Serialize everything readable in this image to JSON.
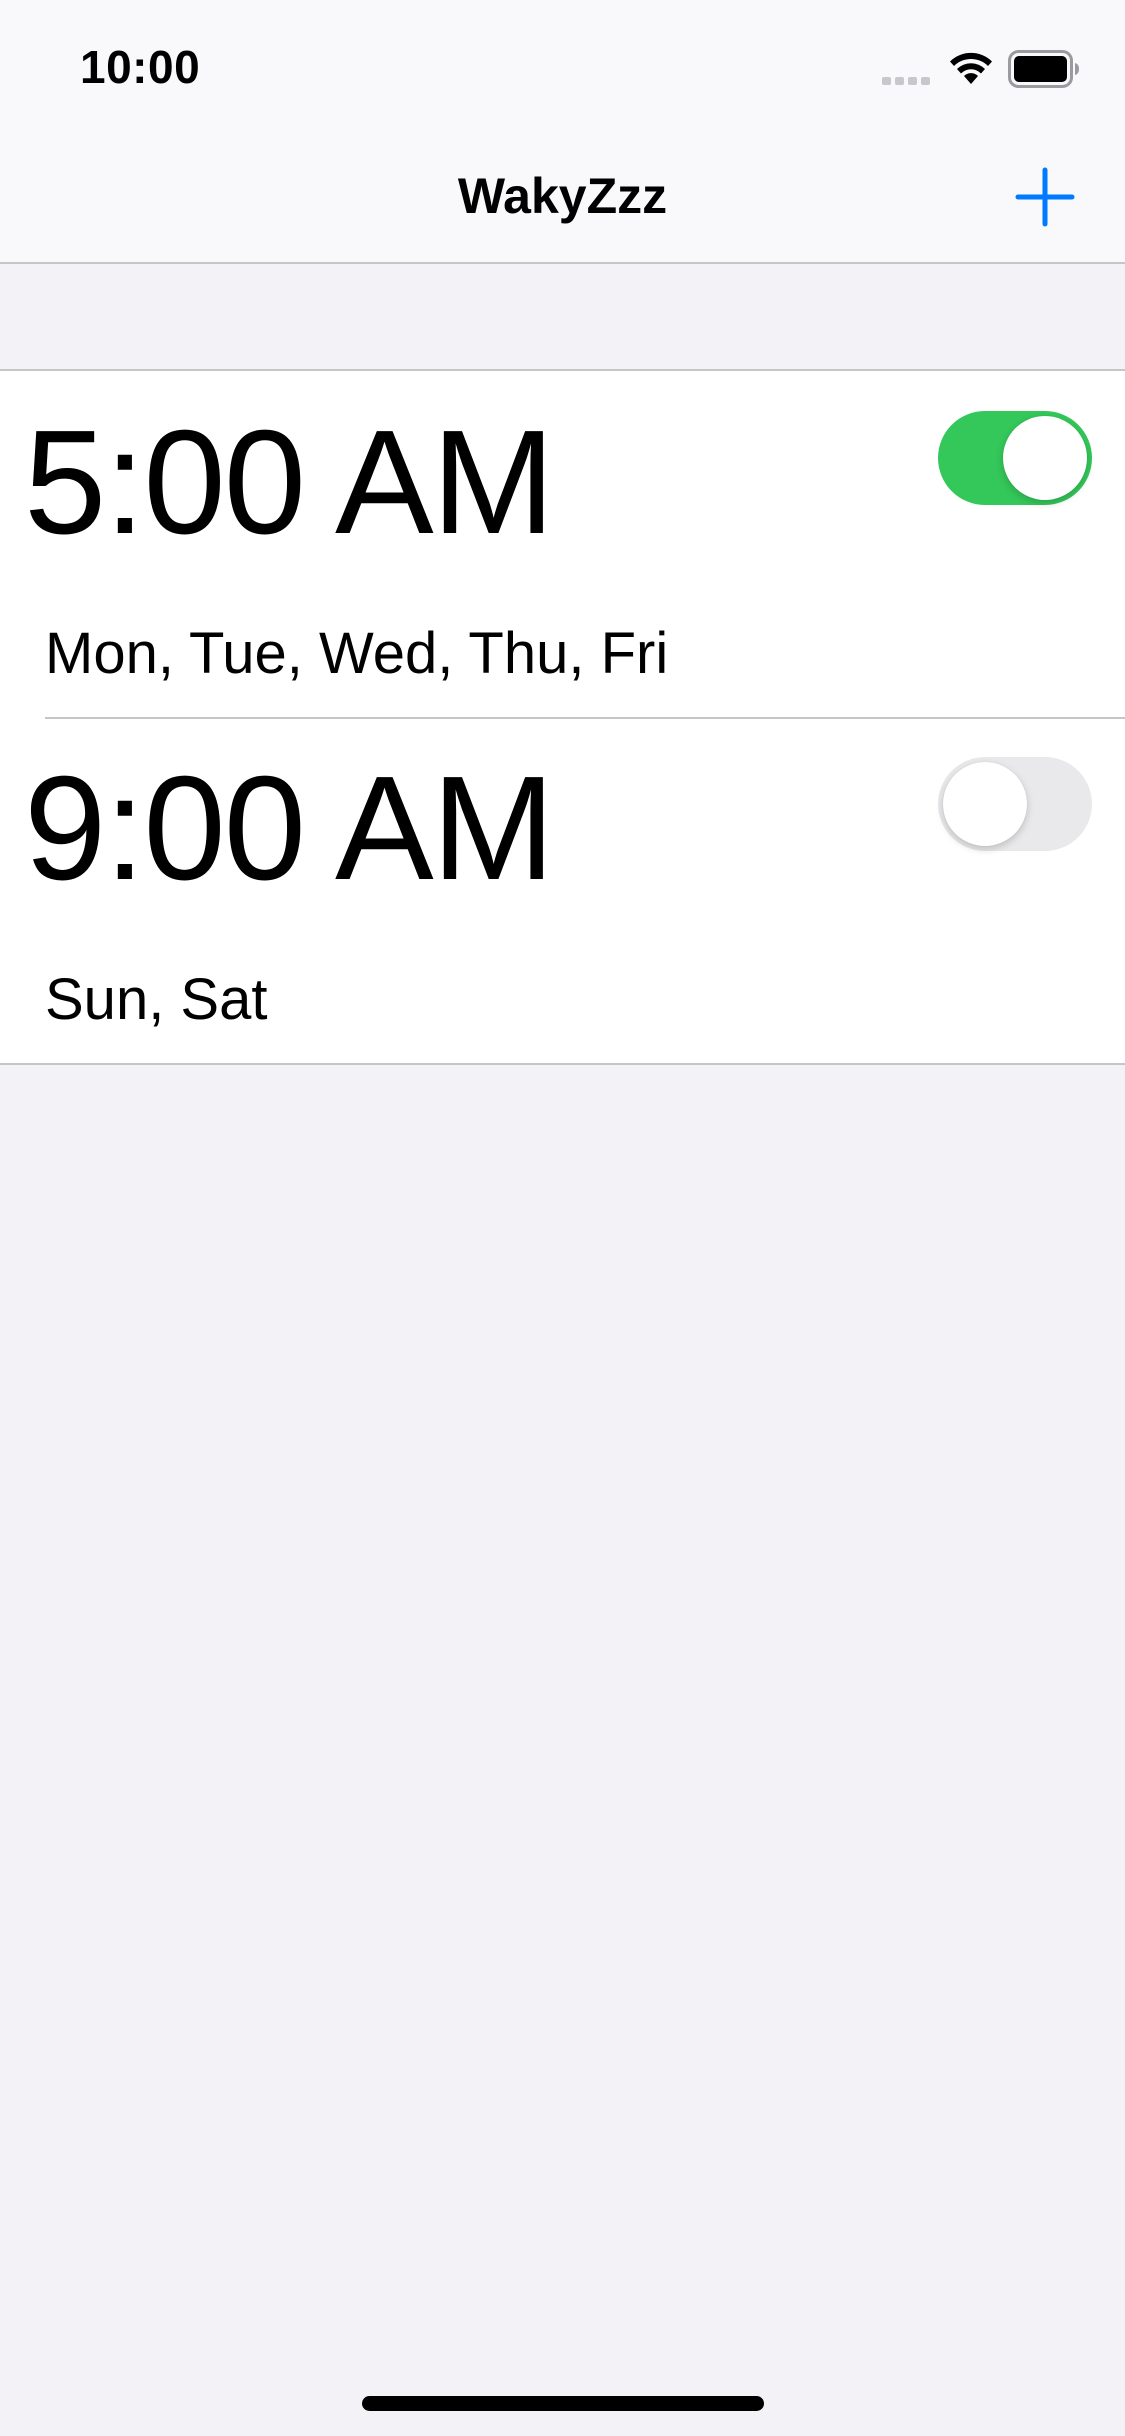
{
  "status_bar": {
    "time": "10:00"
  },
  "nav": {
    "title": "WakyZzz",
    "add_icon": "plus-icon"
  },
  "alarms": [
    {
      "time": "5:00 AM",
      "days": "Mon, Tue, Wed, Thu, Fri",
      "enabled": true
    },
    {
      "time": "9:00 AM",
      "days": "Sun, Sat",
      "enabled": false
    }
  ],
  "colors": {
    "accent": "#007aff",
    "toggle_on": "#34c759",
    "toggle_off": "#e9e9eb",
    "background": "#f2f2f7"
  }
}
